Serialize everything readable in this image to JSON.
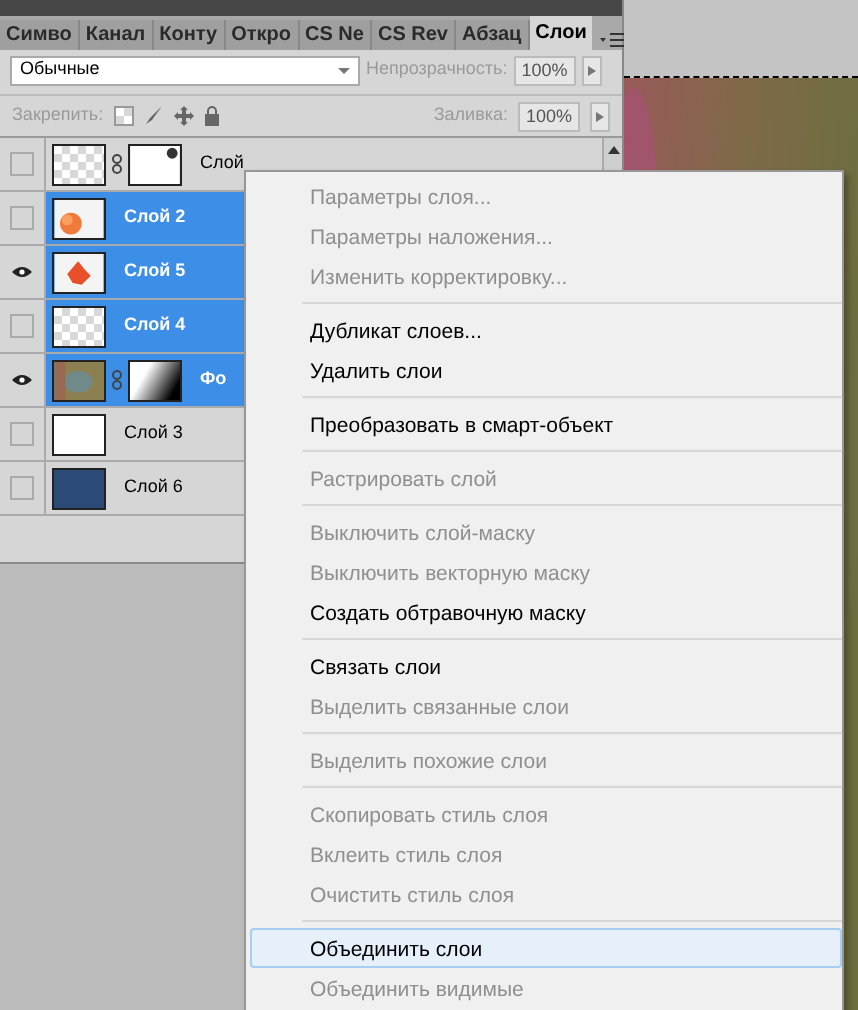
{
  "tabs": [
    {
      "label": "Симво",
      "selected": false
    },
    {
      "label": "Канал",
      "selected": false
    },
    {
      "label": "Конту",
      "selected": false
    },
    {
      "label": "Откро",
      "selected": false
    },
    {
      "label": "CS Ne",
      "selected": false
    },
    {
      "label": "CS Rev",
      "selected": false
    },
    {
      "label": "Абзац",
      "selected": false
    },
    {
      "label": "Слои",
      "selected": true
    }
  ],
  "blend_mode": {
    "value": "Обычные"
  },
  "opacity": {
    "label": "Непрозрачность:",
    "value": "100%",
    "disabled": true
  },
  "lock": {
    "label": "Закрепить:",
    "disabled": true
  },
  "fill": {
    "label": "Заливка:",
    "value": "100%",
    "disabled": true
  },
  "layers": [
    {
      "name": "Слой",
      "visible": false,
      "selected": false,
      "kind": "masked"
    },
    {
      "name": "Слой 2",
      "visible": false,
      "selected": true,
      "kind": "orange"
    },
    {
      "name": "Слой 5",
      "visible": true,
      "selected": true,
      "kind": "red"
    },
    {
      "name": "Слой 4",
      "visible": false,
      "selected": true,
      "kind": "transparent"
    },
    {
      "name": "Фо",
      "visible": true,
      "selected": true
    },
    {
      "name": "Слой 3",
      "visible": false,
      "selected": false,
      "kind": "white"
    },
    {
      "name": "Слой 6",
      "visible": false,
      "selected": false,
      "kind": "navy"
    }
  ],
  "context_menu": [
    [
      {
        "label": "Параметры слоя...",
        "disabled": true,
        "highlighted": false
      },
      {
        "label": "Параметры наложения...",
        "disabled": true,
        "highlighted": false
      },
      {
        "label": "Изменить корректировку...",
        "disabled": true,
        "highlighted": false
      }
    ],
    [
      {
        "label": "Дубликат слоев...",
        "disabled": false,
        "highlighted": false
      },
      {
        "label": "Удалить слои",
        "disabled": false,
        "highlighted": false
      }
    ],
    [
      {
        "label": "Преобразовать в смарт-объект",
        "disabled": false,
        "highlighted": false
      }
    ],
    [
      {
        "label": "Растрировать слой",
        "disabled": true,
        "highlighted": false
      }
    ],
    [
      {
        "label": "Выключить слой-маску",
        "disabled": true,
        "highlighted": false
      },
      {
        "label": "Выключить векторную маску",
        "disabled": true,
        "highlighted": false
      },
      {
        "label": "Создать обтравочную маску",
        "disabled": false,
        "highlighted": false
      }
    ],
    [
      {
        "label": "Связать слои",
        "disabled": false,
        "highlighted": false
      },
      {
        "label": "Выделить связанные слои",
        "disabled": true,
        "highlighted": false
      }
    ],
    [
      {
        "label": "Выделить похожие слои",
        "disabled": true,
        "highlighted": false
      }
    ],
    [
      {
        "label": "Скопировать стиль слоя",
        "disabled": true,
        "highlighted": false
      },
      {
        "label": "Вклеить стиль слоя",
        "disabled": true,
        "highlighted": false
      },
      {
        "label": "Очистить стиль слоя",
        "disabled": true,
        "highlighted": false
      }
    ],
    [
      {
        "label": "Объединить слои",
        "disabled": false,
        "highlighted": true
      },
      {
        "label": "Объединить видимые",
        "disabled": true,
        "highlighted": false
      }
    ]
  ]
}
